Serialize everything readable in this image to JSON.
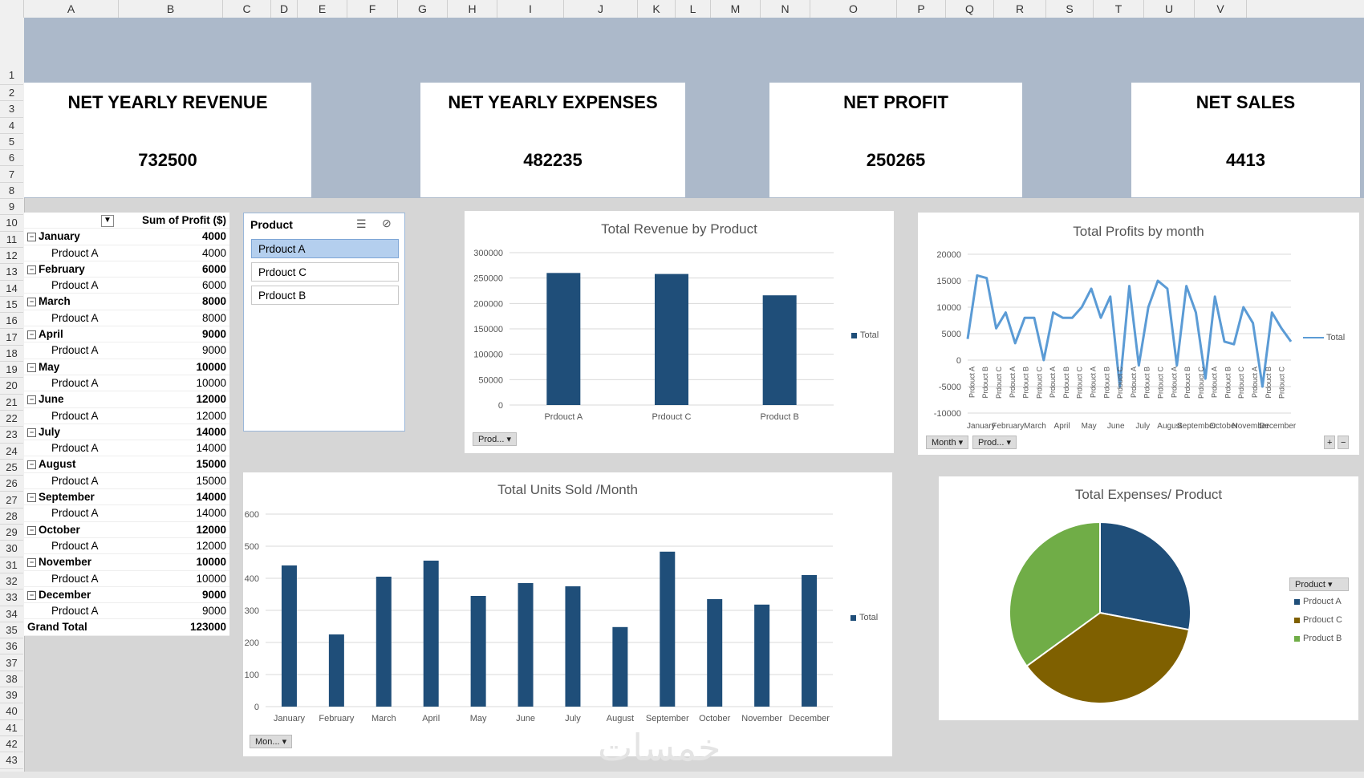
{
  "columns": [
    "A",
    "B",
    "C",
    "D",
    "E",
    "F",
    "G",
    "H",
    "I",
    "J",
    "K",
    "L",
    "M",
    "N",
    "O",
    "P",
    "Q",
    "R",
    "S",
    "T",
    "U",
    "V"
  ],
  "rows": [
    "1",
    "2",
    "3",
    "4",
    "5",
    "6",
    "7",
    "8",
    "9",
    "10",
    "11",
    "12",
    "13",
    "14",
    "15",
    "16",
    "17",
    "18",
    "19",
    "20",
    "21",
    "22",
    "23",
    "24",
    "25",
    "26",
    "27",
    "28",
    "29",
    "30",
    "31",
    "32",
    "33",
    "34",
    "35",
    "36",
    "37",
    "38",
    "39",
    "40",
    "41",
    "42",
    "43"
  ],
  "colors": {
    "banner": "#acb9ca",
    "bar": "#1f4e79",
    "line": "#5b9bd5",
    "pieA": "#1f4e79",
    "pieC": "#7f6000",
    "pieB": "#70ad47"
  },
  "kpis": [
    {
      "title": "NET YEARLY REVENUE",
      "value": "732500"
    },
    {
      "title": "NET YEARLY EXPENSES",
      "value": "482235"
    },
    {
      "title": "NET PROFIT",
      "value": "250265"
    },
    {
      "title": "NET SALES",
      "value": "4413"
    }
  ],
  "pivot": {
    "header_label": "Sum of Profit ($)",
    "rows": [
      {
        "label": "January",
        "value": "4000",
        "type": "month"
      },
      {
        "label": "Prdouct A",
        "value": "4000",
        "type": "child"
      },
      {
        "label": "February",
        "value": "6000",
        "type": "month"
      },
      {
        "label": "Prdouct A",
        "value": "6000",
        "type": "child"
      },
      {
        "label": "March",
        "value": "8000",
        "type": "month"
      },
      {
        "label": "Prdouct A",
        "value": "8000",
        "type": "child"
      },
      {
        "label": "April",
        "value": "9000",
        "type": "month"
      },
      {
        "label": "Prdouct A",
        "value": "9000",
        "type": "child"
      },
      {
        "label": "May",
        "value": "10000",
        "type": "month"
      },
      {
        "label": "Prdouct A",
        "value": "10000",
        "type": "child"
      },
      {
        "label": "June",
        "value": "12000",
        "type": "month"
      },
      {
        "label": "Prdouct A",
        "value": "12000",
        "type": "child"
      },
      {
        "label": "July",
        "value": "14000",
        "type": "month"
      },
      {
        "label": "Prdouct A",
        "value": "14000",
        "type": "child"
      },
      {
        "label": "August",
        "value": "15000",
        "type": "month"
      },
      {
        "label": "Prdouct A",
        "value": "15000",
        "type": "child"
      },
      {
        "label": "September",
        "value": "14000",
        "type": "month"
      },
      {
        "label": "Prdouct A",
        "value": "14000",
        "type": "child"
      },
      {
        "label": "October",
        "value": "12000",
        "type": "month"
      },
      {
        "label": "Prdouct A",
        "value": "12000",
        "type": "child"
      },
      {
        "label": "November",
        "value": "10000",
        "type": "month"
      },
      {
        "label": "Prdouct A",
        "value": "10000",
        "type": "child"
      },
      {
        "label": "December",
        "value": "9000",
        "type": "month"
      },
      {
        "label": "Prdouct A",
        "value": "9000",
        "type": "child"
      },
      {
        "label": "Grand Total",
        "value": "123000",
        "type": "total"
      }
    ]
  },
  "slicer": {
    "title": "Product",
    "items": [
      "Prdouct A",
      "Prdouct C",
      "Prdouct B"
    ],
    "selected": 0
  },
  "watermark": "خمسات",
  "chart_data": [
    {
      "type": "bar",
      "title": "Total Revenue by Product",
      "categories": [
        "Prdouct A",
        "Prdouct C",
        "Product B"
      ],
      "series": [
        {
          "name": "Total",
          "values": [
            260000,
            258000,
            216000
          ]
        }
      ],
      "ylim": [
        0,
        300000
      ],
      "yticks": [
        0,
        50000,
        100000,
        150000,
        200000,
        250000,
        300000
      ],
      "legend": "right",
      "grid": true,
      "filter_button": "Prod..."
    },
    {
      "type": "line",
      "title": "Total Profits by month",
      "months": [
        "January",
        "February",
        "March",
        "April",
        "May",
        "June",
        "July",
        "August",
        "September",
        "October",
        "November",
        "December"
      ],
      "x_products": [
        "Prdouct A",
        "Prdouct B",
        "Prdouct C",
        "Prdouct A",
        "Prdouct B",
        "Prdouct C",
        "Prdouct A",
        "Prdouct B",
        "Prdouct C",
        "Prdouct A",
        "Prdouct B",
        "Prdouct C",
        "Prdouct A",
        "Prdouct B",
        "Prdouct C",
        "Prdouct A",
        "Prdouct B",
        "Prdouct C",
        "Prdouct A",
        "Prdouct B",
        "Prdouct C",
        "Prdouct A",
        "Prdouct B",
        "Prdouct C"
      ],
      "series": [
        {
          "name": "Total",
          "values": [
            4000,
            16000,
            15500,
            6000,
            9000,
            3200,
            8000,
            8000,
            0,
            9000,
            8000,
            8000,
            10000,
            13500,
            8000,
            12000,
            -5000,
            14000,
            -1000,
            10000,
            15000,
            13500,
            -1000,
            14000,
            9000,
            -3500,
            12000,
            3500,
            3000,
            10000,
            7000,
            -5000,
            9000,
            6000,
            3500
          ]
        }
      ],
      "ylim": [
        -10000,
        20000
      ],
      "yticks": [
        -10000,
        -5000,
        0,
        5000,
        10000,
        15000,
        20000
      ],
      "legend": "right",
      "grid": true,
      "filter_buttons": [
        "Month",
        "Prod..."
      ]
    },
    {
      "type": "bar",
      "title": "Total Units Sold /Month",
      "categories": [
        "January",
        "February",
        "March",
        "April",
        "May",
        "June",
        "July",
        "August",
        "September",
        "October",
        "November",
        "December"
      ],
      "series": [
        {
          "name": "Total",
          "values": [
            440,
            225,
            405,
            455,
            345,
            385,
            375,
            248,
            483,
            335,
            318,
            410
          ]
        }
      ],
      "ylim": [
        0,
        600
      ],
      "yticks": [
        0,
        100,
        200,
        300,
        400,
        500,
        600
      ],
      "legend": "right",
      "grid": true,
      "filter_button": "Mon..."
    },
    {
      "type": "pie",
      "title": "Total Expenses/ Product",
      "categories": [
        "Prdouct A",
        "Prdouct C",
        "Product B"
      ],
      "series": [
        {
          "name": "Product",
          "values": [
            28,
            37,
            35
          ]
        }
      ],
      "legend": "right",
      "filter_button": "Product"
    }
  ]
}
